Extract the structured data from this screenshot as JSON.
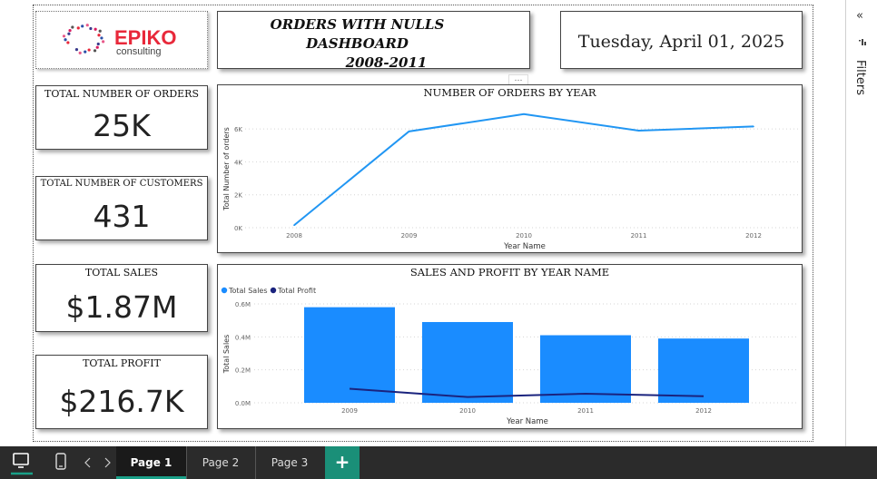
{
  "report": {
    "title_line1": "ORDERS WITH NULLS DASHBOARD",
    "title_line2": "2008-2011",
    "date": "Tuesday, April 01, 2025",
    "logo": {
      "brand": "EPIKO",
      "sub": "consulting",
      "brand_color": "#e8283a"
    }
  },
  "cards": [
    {
      "label": "TOTAL NUMBER OF ORDERS",
      "value": "25K"
    },
    {
      "label": "TOTAL NUMBER OF CUSTOMERS",
      "value": "431"
    },
    {
      "label": "TOTAL SALES",
      "value": "$1.87M"
    },
    {
      "label": "TOTAL PROFIT",
      "value": "$216.7K"
    }
  ],
  "filters": {
    "label": "Filters",
    "collapse_icon": "double-chevron-left-icon",
    "filter_icon": "funnel-icon"
  },
  "tabs": {
    "desktop_icon": "desktop-icon",
    "mobile_icon": "mobile-icon",
    "prev_icon": "caret-left-icon",
    "next_icon": "caret-right-icon",
    "pages": [
      "Page 1",
      "Page 2",
      "Page 3"
    ],
    "active": 0,
    "add_label": "+"
  },
  "more_options": "…",
  "colors": {
    "accent": "#1a8f78",
    "line": "#2196f3",
    "bar": "#1a8cff",
    "profit": "#1a237e"
  },
  "chart_data": [
    {
      "type": "line",
      "title": "NUMBER OF ORDERS BY YEAR",
      "xlabel": "Year Name",
      "ylabel": "Total Number of orders",
      "categories": [
        "2008",
        "2009",
        "2010",
        "2011",
        "2012"
      ],
      "y_ticks": [
        "0K",
        "2K",
        "4K",
        "6K"
      ],
      "ylim": [
        0,
        7000
      ],
      "grid": true,
      "series": [
        {
          "values": [
            150,
            5850,
            6900,
            5900,
            6150
          ]
        }
      ]
    },
    {
      "type": "bar",
      "title": "SALES AND PROFIT BY YEAR NAME",
      "xlabel": "Year Name",
      "ylabel": "Total Sales",
      "categories": [
        "2009",
        "2010",
        "2011",
        "2012"
      ],
      "y_ticks": [
        "0.0M",
        "0.2M",
        "0.4M",
        "0.6M"
      ],
      "ylim": [
        0,
        0.6
      ],
      "legend": "top-left",
      "grid": true,
      "series": [
        {
          "name": "Total Sales",
          "type": "bar",
          "values": [
            0.58,
            0.49,
            0.41,
            0.39
          ]
        },
        {
          "name": "Total Profit",
          "type": "line",
          "values": [
            0.085,
            0.035,
            0.055,
            0.04
          ]
        }
      ]
    }
  ]
}
